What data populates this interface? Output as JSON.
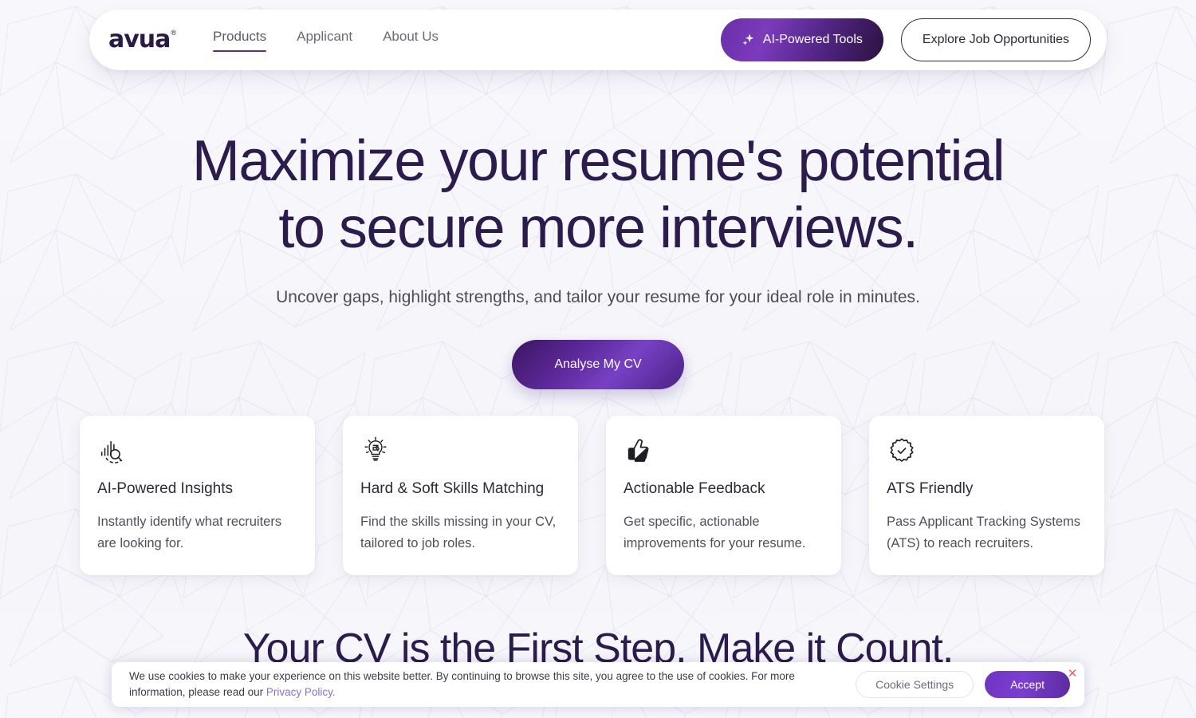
{
  "brand": {
    "name": "avua",
    "trademark": "®",
    "accent": "#5b2d8e"
  },
  "header": {
    "nav": [
      {
        "label": "Products",
        "active": true
      },
      {
        "label": "Applicant",
        "active": false
      },
      {
        "label": "About Us",
        "active": false
      }
    ],
    "ai_button": {
      "label": "AI-Powered Tools",
      "icon": "sparkles-icon"
    },
    "jobs_button": {
      "label": "Explore Job Opportunities"
    }
  },
  "hero": {
    "title_line1": "Maximize your resume's potential",
    "title_line2": "to secure more interviews.",
    "subtitle": "Uncover gaps, highlight strengths, and tailor your resume for your ideal role in minutes.",
    "cta_label": "Analyse My CV"
  },
  "features": [
    {
      "icon": "bar-chart-search-icon",
      "title": "AI-Powered Insights",
      "desc": "Instantly identify what recruiters are looking for."
    },
    {
      "icon": "lightbulb-puzzle-icon",
      "title": "Hard & Soft Skills Matching",
      "desc": "Find the skills missing in your CV, tailored to job roles."
    },
    {
      "icon": "thumbs-up-icon",
      "title": "Actionable Feedback",
      "desc": "Get specific, actionable improvements for your resume."
    },
    {
      "icon": "verified-badge-icon",
      "title": "ATS Friendly",
      "desc": "Pass Applicant Tracking Systems (ATS) to reach recruiters."
    }
  ],
  "section": {
    "heading": "Your CV is the First Step. Make it Count."
  },
  "cookie": {
    "text_part1": "We use cookies to make your experience on this website better. By continuing to browse this site, you agree to the use of cookies. For more information, please read our ",
    "link_label": "Privacy Policy.",
    "settings_label": "Cookie Settings",
    "accept_label": "Accept",
    "close_label": "✕"
  }
}
